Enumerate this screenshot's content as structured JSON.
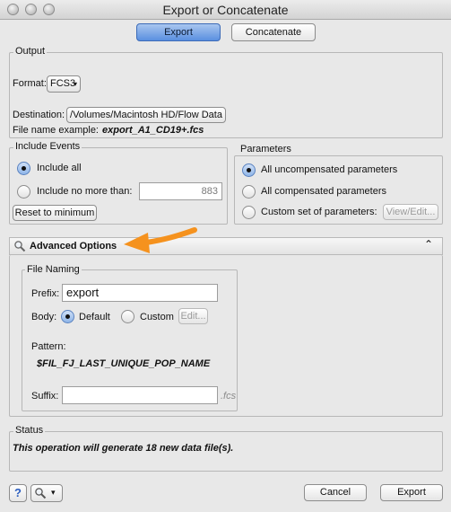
{
  "window": {
    "title": "Export or Concatenate"
  },
  "mode_tabs": {
    "export": "Export",
    "concatenate": "Concatenate"
  },
  "output": {
    "label": "Output",
    "format_label": "Format:",
    "format_value": "FCS3",
    "destination_label": "Destination:",
    "destination_value": "/Volumes/Macintosh HD/Flow Data",
    "filename_example_label": "File name example:",
    "filename_example_value": "export_A1_CD19+.fcs"
  },
  "include_events": {
    "label": "Include Events",
    "include_all": "Include all",
    "include_no_more_than": "Include no more than:",
    "limit_value": "883",
    "reset_button": "Reset to minimum"
  },
  "parameters": {
    "label": "Parameters",
    "all_uncompensated": "All uncompensated parameters",
    "all_compensated": "All compensated parameters",
    "custom_set": "Custom set of parameters:",
    "view_edit_button": "View/Edit..."
  },
  "advanced": {
    "title": "Advanced Options",
    "file_naming": {
      "label": "File Naming",
      "prefix_label": "Prefix:",
      "prefix_value": "export",
      "body_label": "Body:",
      "body_default": "Default",
      "body_custom": "Custom",
      "edit_button": "Edit...",
      "pattern_label": "Pattern:",
      "pattern_value": "$FIL_FJ_LAST_UNIQUE_POP_NAME",
      "suffix_label": "Suffix:",
      "suffix_value": "",
      "suffix_ext": ".fcs"
    }
  },
  "status": {
    "label": "Status",
    "message": "This operation will generate 18 new data file(s)."
  },
  "footer": {
    "help": "?",
    "cancel": "Cancel",
    "export": "Export"
  },
  "colors": {
    "accent_blue": "#5a8fe0",
    "annotation_arrow": "#f5921e"
  }
}
